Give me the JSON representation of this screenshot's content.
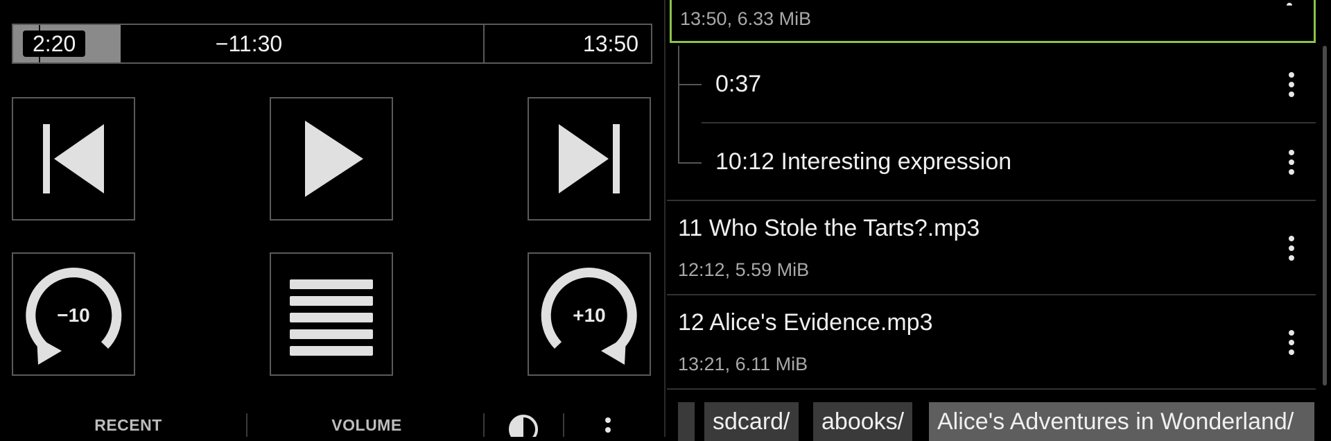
{
  "player": {
    "elapsed": "2:20",
    "remaining": "−11:30",
    "total": "13:50",
    "progress_fraction": 0.169,
    "rewind_label": "−10",
    "forward_label": "+10",
    "bottom_bar": {
      "recent_label": "RECENT",
      "volume_label": "VOLUME"
    }
  },
  "list": {
    "current_track_meta": "13:50, 6.33 MiB",
    "bookmarks": [
      {
        "label": "0:37"
      },
      {
        "label": "10:12 Interesting expression"
      }
    ],
    "tracks": [
      {
        "title": "11 Who Stole the Tarts?.mp3",
        "meta": "12:12, 5.59 MiB"
      },
      {
        "title": "12 Alice's Evidence.mp3",
        "meta": "13:21, 6.11 MiB"
      }
    ]
  },
  "breadcrumb": [
    "sdcard/",
    "abooks/",
    "Alice's Adventures in Wonderland/"
  ],
  "colors": {
    "accent_current": "#8bc34a",
    "progress_fill": "#8a8a8a",
    "button_border": "#5a5a5a"
  }
}
